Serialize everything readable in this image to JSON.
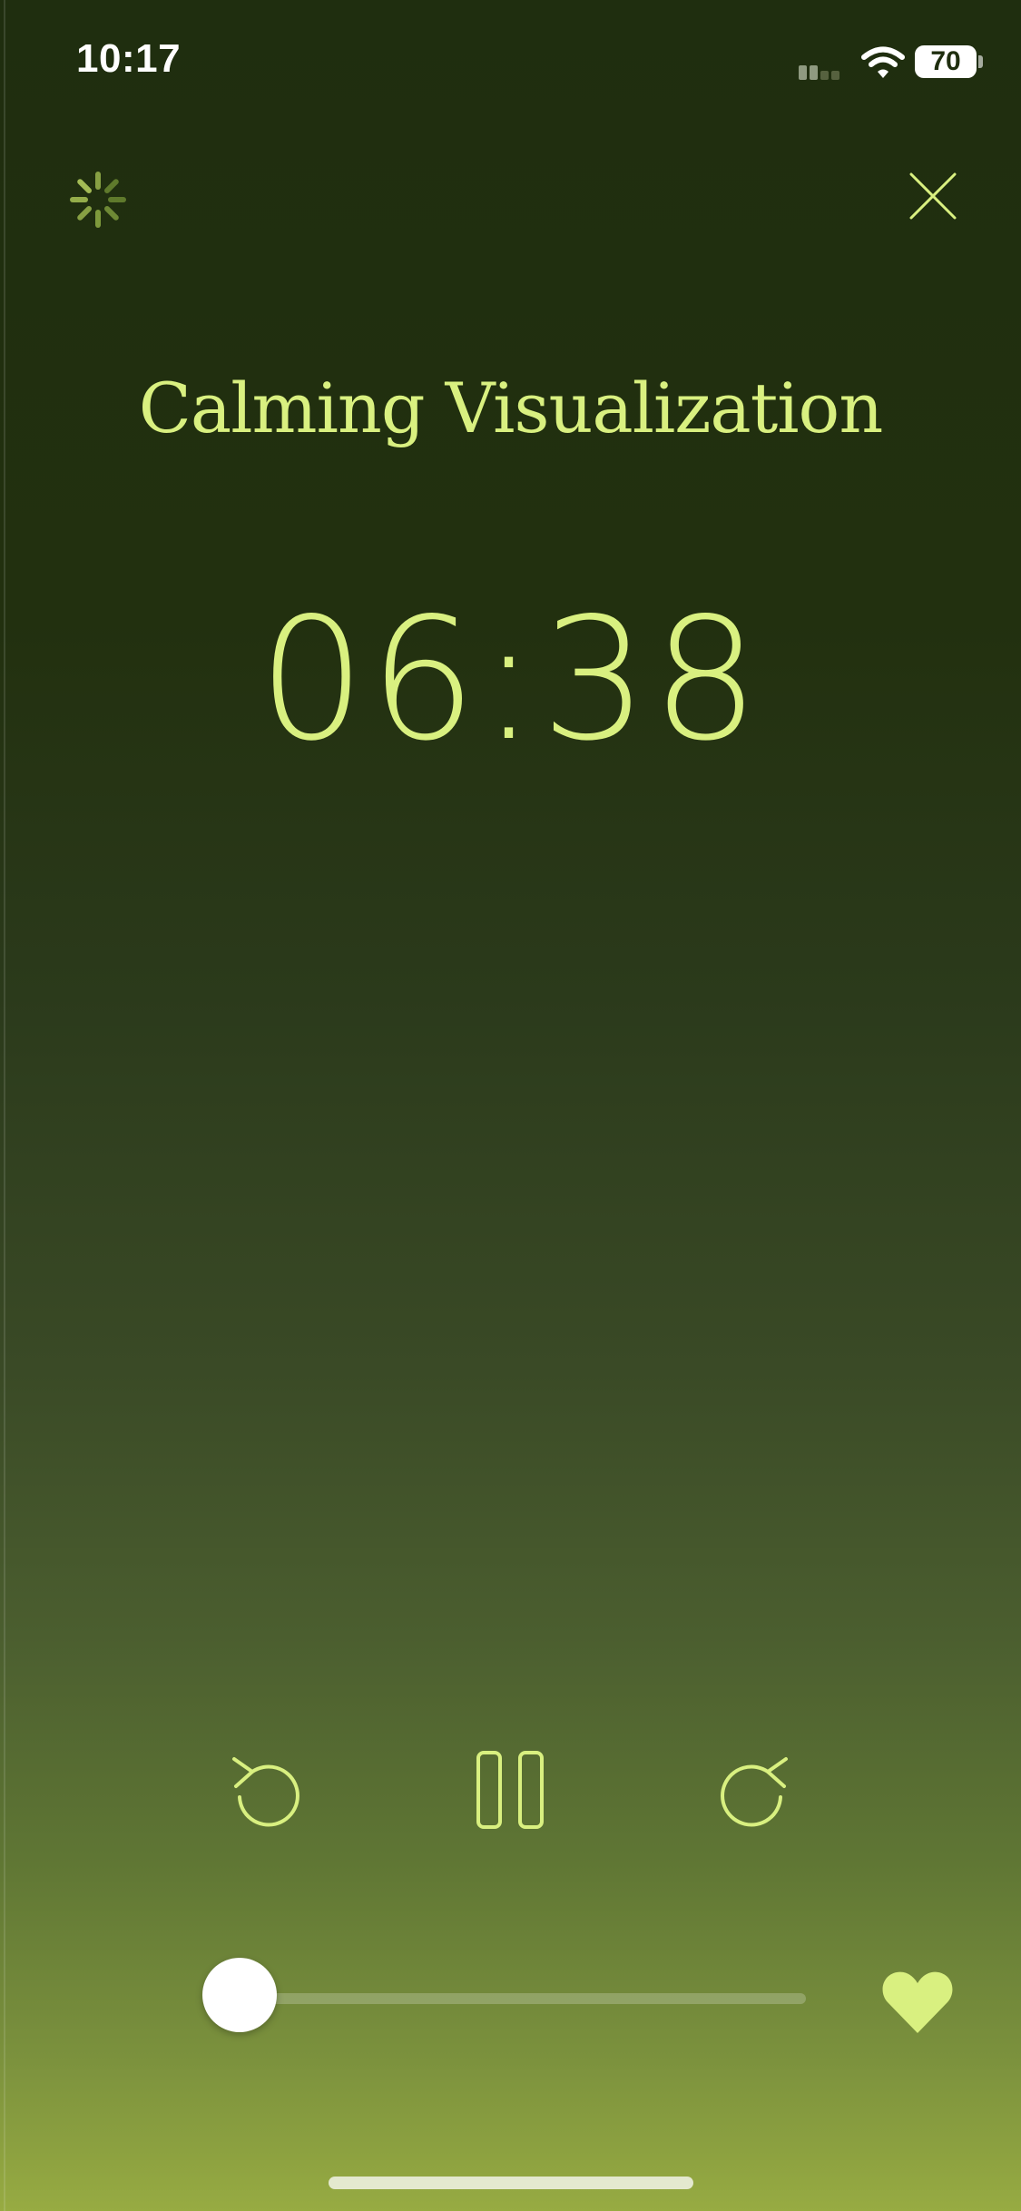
{
  "status_bar": {
    "time": "10:17",
    "battery": "70"
  },
  "header": {
    "left_icon": "loading-spinner-icon",
    "right_icon": "close-icon"
  },
  "session": {
    "title": "Calming Visualization",
    "remaining_time": "06:38"
  },
  "controls": {
    "rewind_icon": "rewind-icon",
    "pause_icon": "pause-icon",
    "forward_icon": "forward-icon"
  },
  "progress": {
    "fraction": 0.04,
    "favorite_icon": "heart-icon"
  },
  "colors": {
    "accent": "#d9f080",
    "background_top": "#1f2e0f",
    "background_bottom": "#97ab42"
  }
}
